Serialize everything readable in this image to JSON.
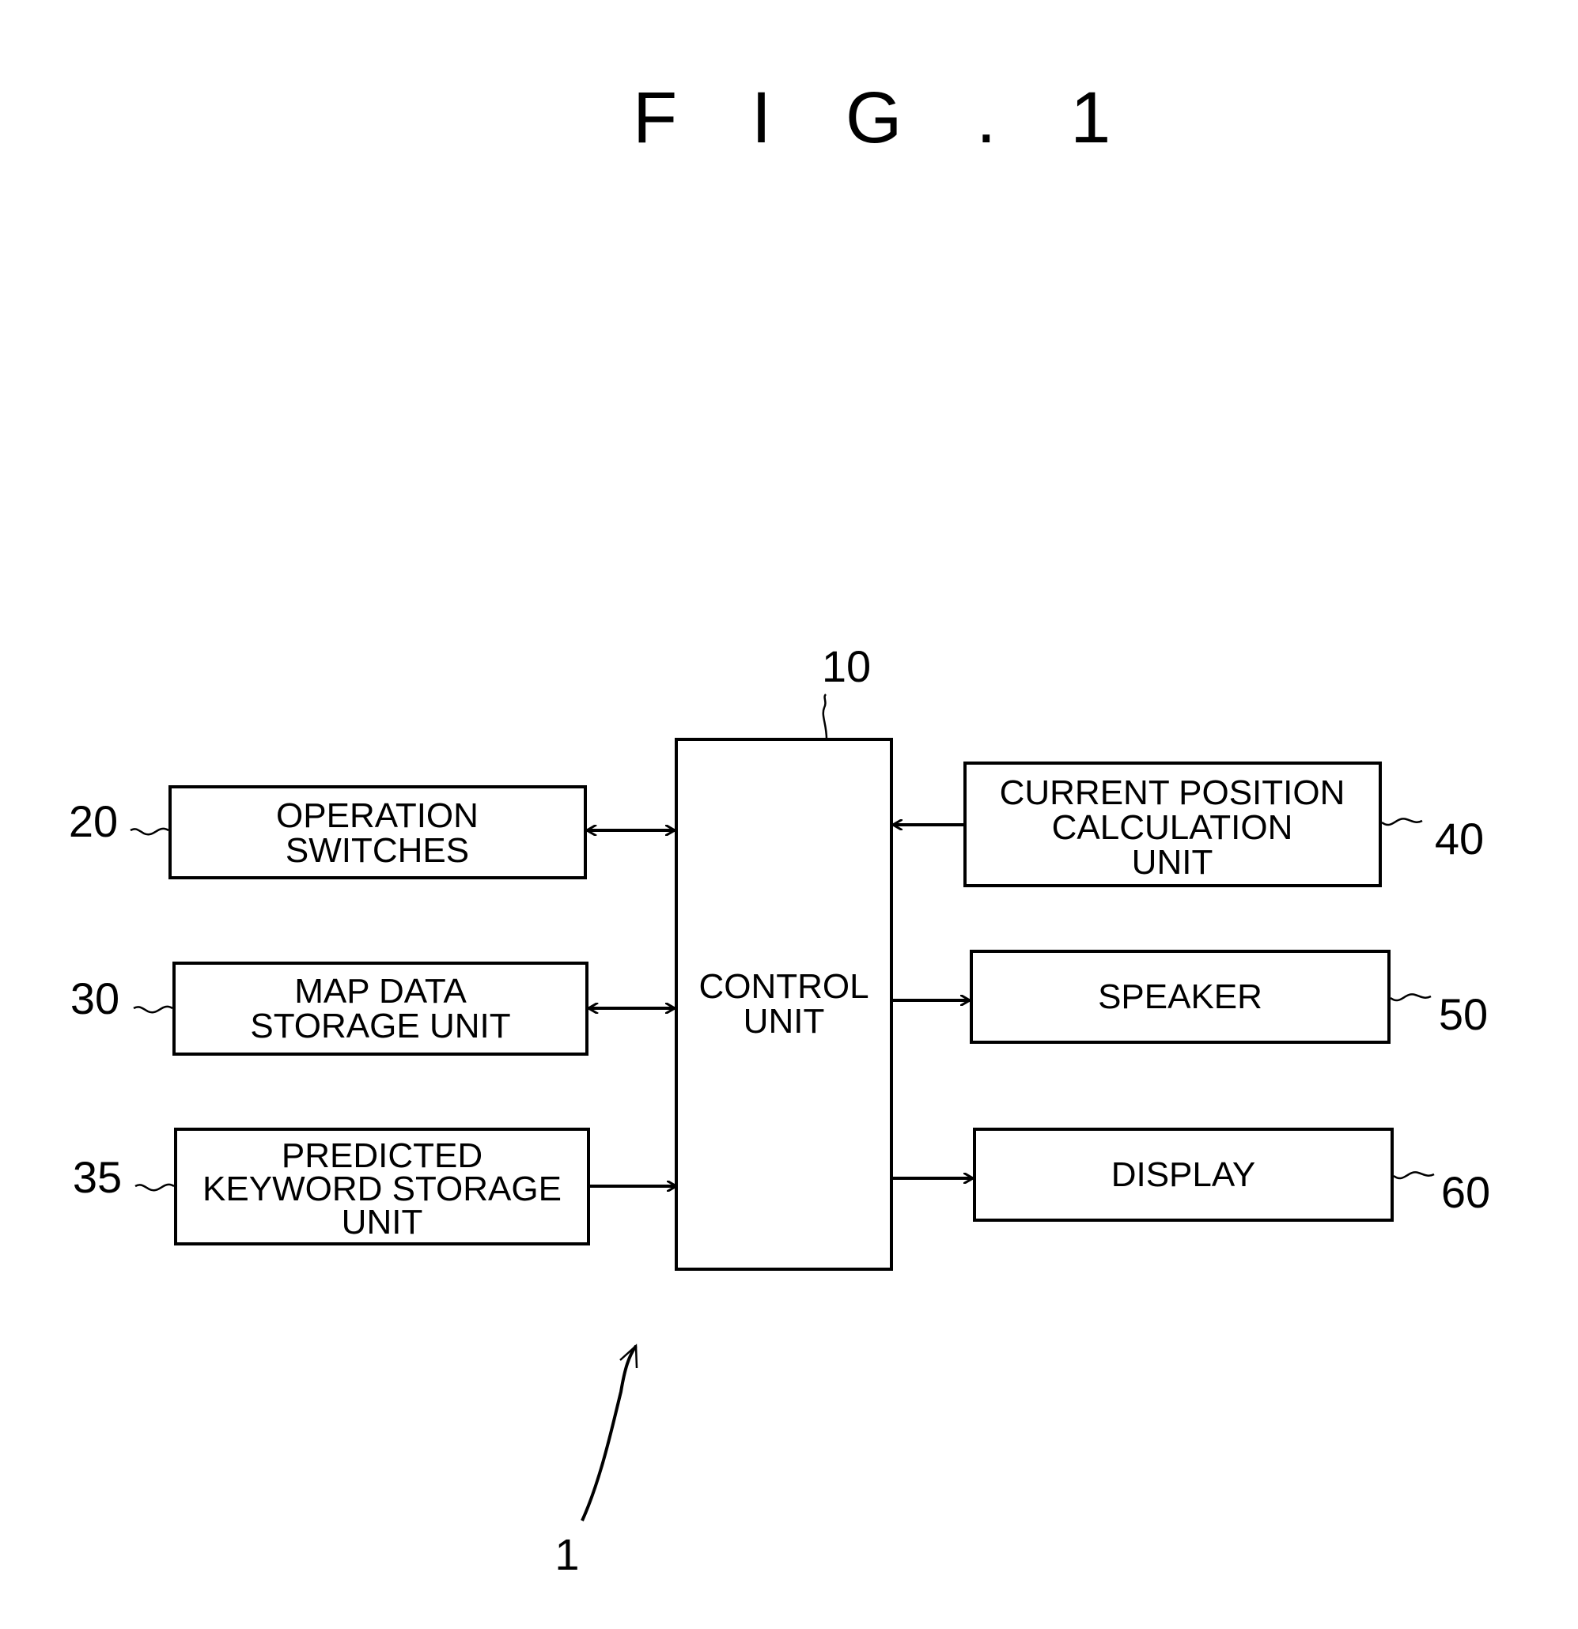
{
  "figure": {
    "title": "F I G . 1",
    "system_ref": "1"
  },
  "control_unit": {
    "ref": "10",
    "label_lines": [
      "CONTROL",
      "UNIT"
    ]
  },
  "left_blocks": [
    {
      "ref": "20",
      "label_lines": [
        "OPERATION",
        "SWITCHES"
      ],
      "connection": "bidirectional"
    },
    {
      "ref": "30",
      "label_lines": [
        "MAP DATA",
        "STORAGE UNIT"
      ],
      "connection": "bidirectional"
    },
    {
      "ref": "35",
      "label_lines": [
        "PREDICTED",
        "KEYWORD STORAGE",
        "UNIT"
      ],
      "connection": "to-control"
    }
  ],
  "right_blocks": [
    {
      "ref": "40",
      "label_lines": [
        "CURRENT POSITION",
        "CALCULATION",
        "UNIT"
      ],
      "connection": "to-control"
    },
    {
      "ref": "50",
      "label_lines": [
        "SPEAKER"
      ],
      "connection": "from-control"
    },
    {
      "ref": "60",
      "label_lines": [
        "DISPLAY"
      ],
      "connection": "from-control"
    }
  ]
}
